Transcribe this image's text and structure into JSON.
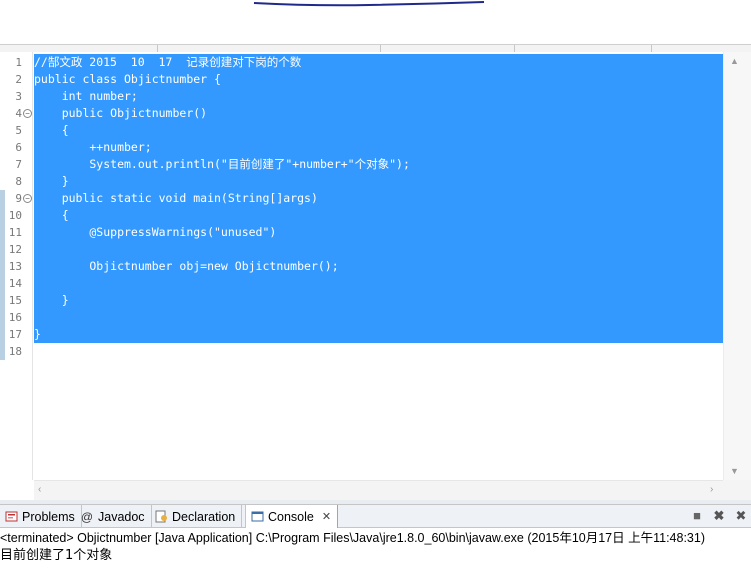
{
  "editor": {
    "lines": [
      {
        "num": "1",
        "text": "//郜文政 2015  10  17  记录创建对下岗的个数",
        "fold": false,
        "selected": true
      },
      {
        "num": "2",
        "text": "public class Objictnumber {",
        "fold": false,
        "selected": true
      },
      {
        "num": "3",
        "text": "    int number;",
        "fold": false,
        "selected": true
      },
      {
        "num": "4",
        "text": "    public Objictnumber()",
        "fold": true,
        "selected": true
      },
      {
        "num": "5",
        "text": "    {",
        "fold": false,
        "selected": true
      },
      {
        "num": "6",
        "text": "        ++number;",
        "fold": false,
        "selected": true
      },
      {
        "num": "7",
        "text": "        System.out.println(\"目前创建了\"+number+\"个对象\");",
        "fold": false,
        "selected": true
      },
      {
        "num": "8",
        "text": "    }",
        "fold": false,
        "selected": true
      },
      {
        "num": "9",
        "text": "    public static void main(String[]args)",
        "fold": true,
        "selected": true
      },
      {
        "num": "10",
        "text": "    {",
        "fold": false,
        "selected": true
      },
      {
        "num": "11",
        "text": "        @SuppressWarnings(\"unused\")",
        "fold": false,
        "selected": true
      },
      {
        "num": "12",
        "text": "",
        "fold": false,
        "selected": true
      },
      {
        "num": "13",
        "text": "        Objictnumber obj=new Objictnumber();",
        "fold": false,
        "selected": true
      },
      {
        "num": "14",
        "text": "",
        "fold": false,
        "selected": true
      },
      {
        "num": "15",
        "text": "    }",
        "fold": false,
        "selected": true
      },
      {
        "num": "16",
        "text": "",
        "fold": false,
        "selected": true
      },
      {
        "num": "17",
        "text": "}",
        "fold": false,
        "selected": true
      },
      {
        "num": "18",
        "text": "",
        "fold": false,
        "selected": false
      }
    ],
    "selection_color": "#3399ff"
  },
  "bottom_panel": {
    "tabs": [
      {
        "label": "Problems",
        "icon": "problems-icon",
        "active": false
      },
      {
        "label": "Javadoc",
        "icon": "at-sign-icon",
        "active": false
      },
      {
        "label": "Declaration",
        "icon": "declaration-icon",
        "active": false
      },
      {
        "label": "Console",
        "icon": "console-icon",
        "active": true
      }
    ],
    "console_header": "<terminated> Objictnumber [Java Application] C:\\Program Files\\Java\\jre1.8.0_60\\bin\\javaw.exe (2015年10月17日 上午11:48:31)",
    "console_output": "目前创建了1个对象"
  }
}
